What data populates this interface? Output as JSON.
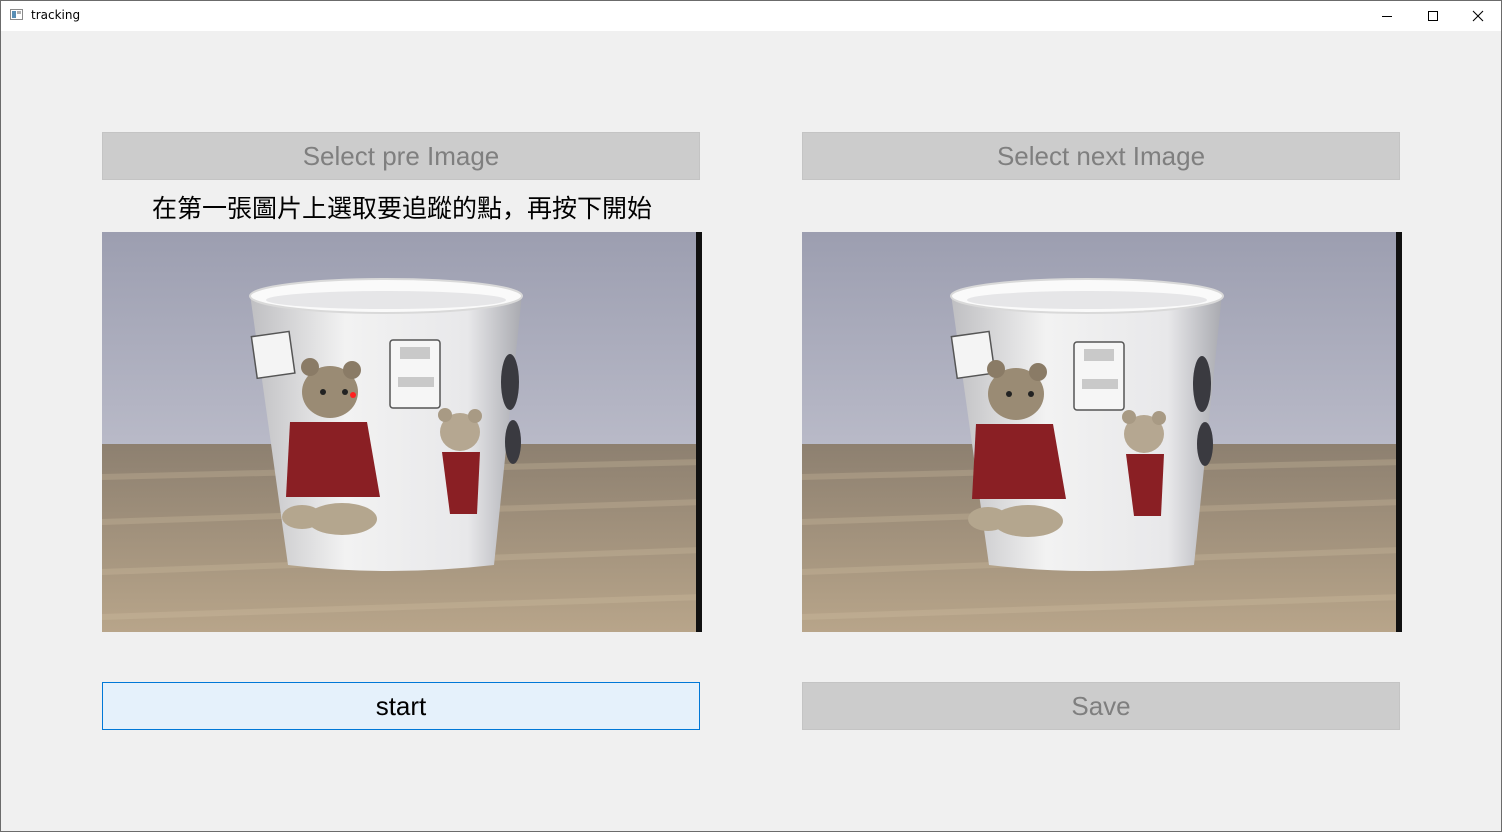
{
  "window": {
    "title": "tracking",
    "controls": {
      "minimize": "minimize-icon",
      "maximize": "maximize-icon",
      "close": "close-icon"
    }
  },
  "buttons": {
    "select_pre": "Select pre Image",
    "select_next": "Select next Image",
    "start": "start",
    "save": "Save"
  },
  "instruction": "在第一張圖片上選取要追蹤的點，再按下開始",
  "images": {
    "pre": {
      "has_marker": true,
      "marker_color": "#ff2020"
    },
    "next": {
      "has_marker": false
    }
  },
  "colors": {
    "background": "#f0f0f0",
    "disabled_button": "#cccccc",
    "disabled_text": "#7f7f7f",
    "active_button": "#e5f1fb",
    "active_border": "#0078d7"
  }
}
